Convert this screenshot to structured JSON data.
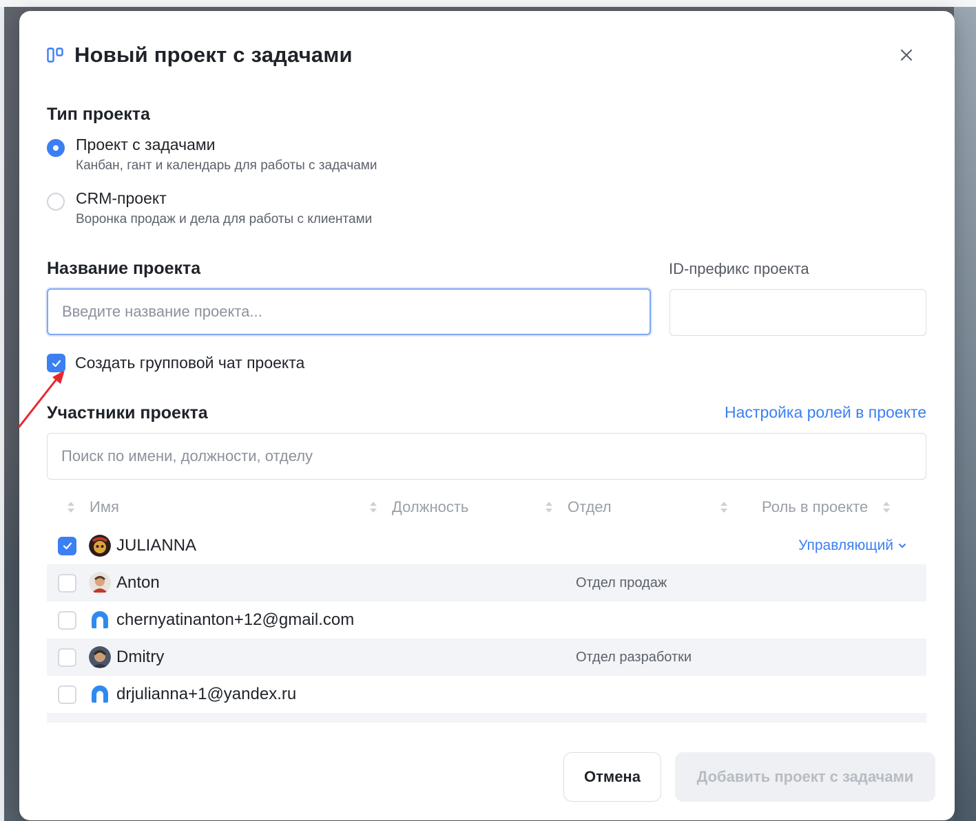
{
  "modal": {
    "title": "Новый проект с задачами",
    "project_type": {
      "title": "Тип проекта",
      "options": [
        {
          "label": "Проект с задачами",
          "description": "Канбан, гант и календарь для работы с задачами",
          "selected": true
        },
        {
          "label": "CRM-проект",
          "description": "Воронка продаж и дела для работы с клиентами",
          "selected": false
        }
      ]
    },
    "name_field": {
      "label": "Название проекта",
      "placeholder": "Введите название проекта..."
    },
    "prefix_field": {
      "label": "ID-префикс проекта",
      "value": ""
    },
    "group_chat": {
      "label": "Создать групповой чат проекта",
      "checked": true
    },
    "members": {
      "title": "Участники проекта",
      "roles_link": "Настройка ролей в проекте",
      "search_placeholder": "Поиск по имени, должности, отделу",
      "columns": [
        "Имя",
        "Должность",
        "Отдел",
        "Роль в проекте"
      ],
      "rows": [
        {
          "name": "JULIANNA",
          "department": "",
          "role": "Управляющий",
          "checked": true,
          "avatar": "photo"
        },
        {
          "name": "Anton",
          "department": "Отдел продаж",
          "role": "",
          "checked": false,
          "avatar": "photo"
        },
        {
          "name": "chernyatinanton+12@gmail.com",
          "department": "",
          "role": "",
          "checked": false,
          "avatar": "default"
        },
        {
          "name": "Dmitry",
          "department": "Отдел разработки",
          "role": "",
          "checked": false,
          "avatar": "photo"
        },
        {
          "name": "drjulianna+1@yandex.ru",
          "department": "",
          "role": "",
          "checked": false,
          "avatar": "default"
        }
      ]
    },
    "buttons": {
      "cancel": "Отмена",
      "submit": "Добавить проект с задачами"
    }
  },
  "colors": {
    "accent": "#3b7ff3",
    "annotation_arrow": "#e8262b"
  }
}
